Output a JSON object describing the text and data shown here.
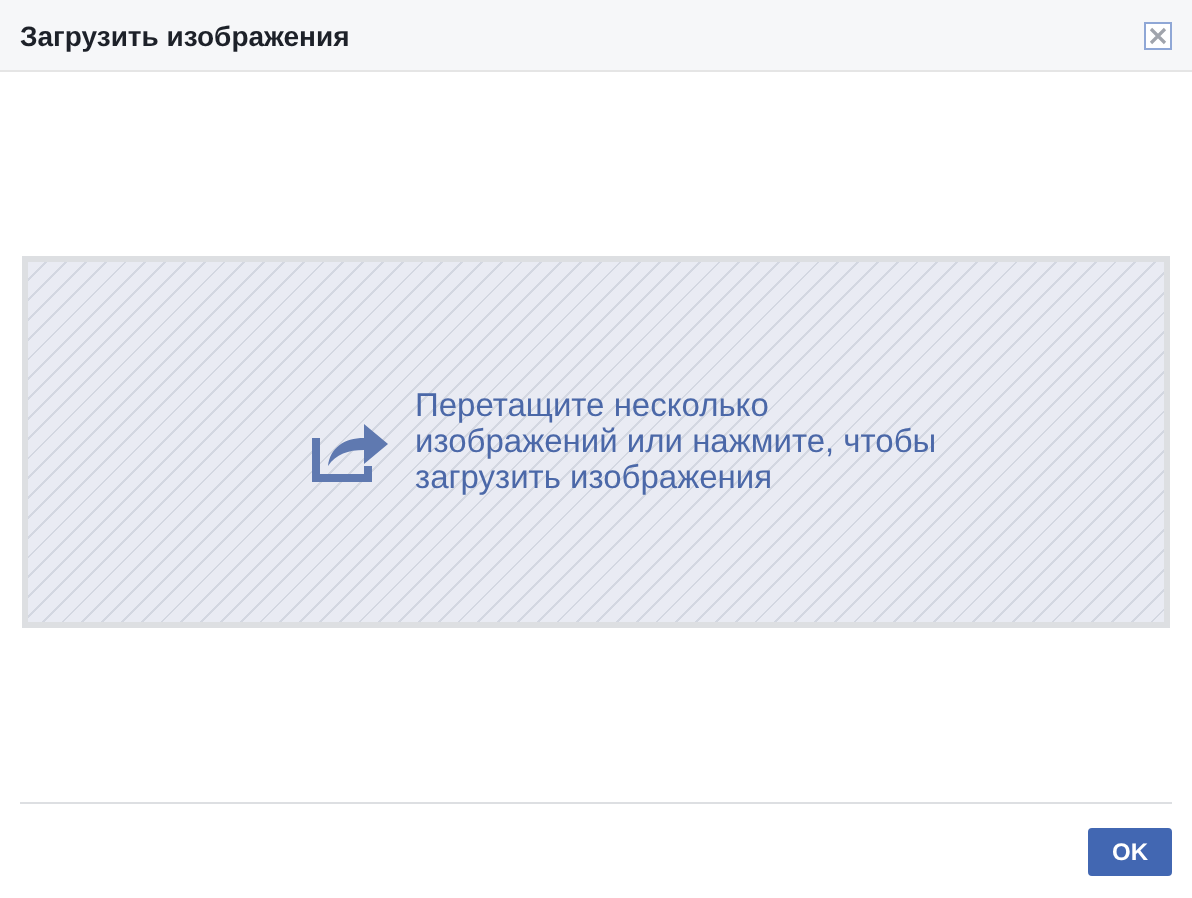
{
  "window": {
    "title": "Загрузить изображения"
  },
  "dropzone": {
    "text": "Перетащите несколько изображений или нажмите, чтобы загрузить изображения"
  },
  "buttons": [
    "OK"
  ]
}
